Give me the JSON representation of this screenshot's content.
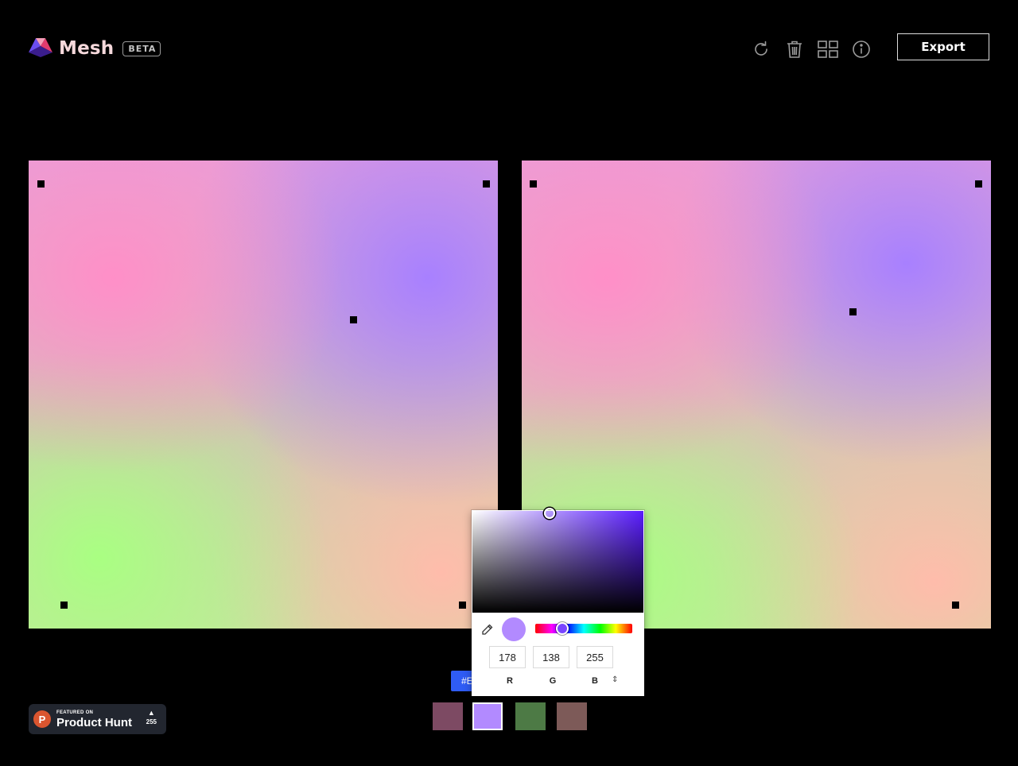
{
  "app": {
    "name": "Mesh",
    "badge": "BETA"
  },
  "toolbar": {
    "icons": [
      "refresh-icon",
      "trash-icon",
      "grid-icon",
      "info-icon"
    ],
    "export_label": "Export"
  },
  "canvases": [
    {
      "id": "mesh-preview-left"
    },
    {
      "id": "mesh-preview-right"
    }
  ],
  "color_picker": {
    "r": "178",
    "g": "138",
    "b": "255",
    "r_label": "R",
    "g_label": "G",
    "b_label": "B",
    "mode_toggle": "⇕",
    "preview_color": "#b28aff",
    "hue_color": "#5a1dff"
  },
  "hex_chip": {
    "visible_text": "#E",
    "color": "#2f5cf5"
  },
  "palette": {
    "colors": [
      "#7d4a63",
      "#b28aff",
      "#4d7a45",
      "#7d5a58"
    ],
    "selected_index": 1
  },
  "product_hunt": {
    "featured_label": "FEATURED ON",
    "name": "Product Hunt",
    "votes": "255"
  }
}
